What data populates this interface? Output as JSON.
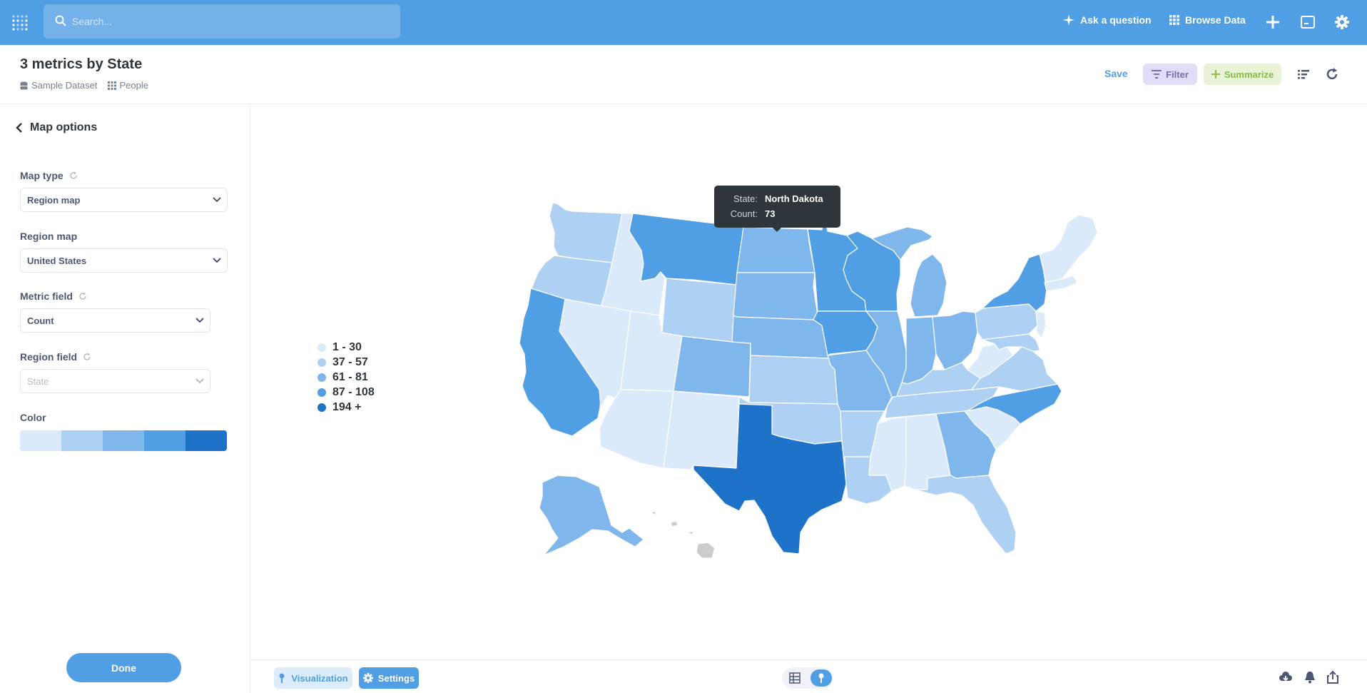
{
  "nav": {
    "search_placeholder": "Search...",
    "ask_question": "Ask a question",
    "browse_data": "Browse Data"
  },
  "header": {
    "title": "3 metrics by State",
    "database": "Sample Dataset",
    "table": "People",
    "save": "Save",
    "filter": "Filter",
    "summarize": "Summarize"
  },
  "sidebar": {
    "back_label": "Map options",
    "map_type_label": "Map type",
    "map_type_value": "Region map",
    "region_map_label": "Region map",
    "region_map_value": "United States",
    "metric_field_label": "Metric field",
    "metric_field_value": "Count",
    "region_field_label": "Region field",
    "region_field_value": "State",
    "color_label": "Color",
    "colors": [
      "#dbeafa",
      "#aed0f3",
      "#7fb6ec",
      "#509ee3",
      "#1e73c8"
    ],
    "done": "Done"
  },
  "legend": [
    {
      "label": "1 - 30",
      "color": "#dbeafa"
    },
    {
      "label": "37 - 57",
      "color": "#aed0f3"
    },
    {
      "label": "61 - 81",
      "color": "#7fb6ec"
    },
    {
      "label": "87 - 108",
      "color": "#509ee3"
    },
    {
      "label": "194 +",
      "color": "#1e73c8"
    }
  ],
  "tooltip": {
    "state_key": "State:",
    "state_value": "North Dakota",
    "count_key": "Count:",
    "count_value": "73"
  },
  "footer": {
    "visualization": "Visualization",
    "settings": "Settings"
  }
}
